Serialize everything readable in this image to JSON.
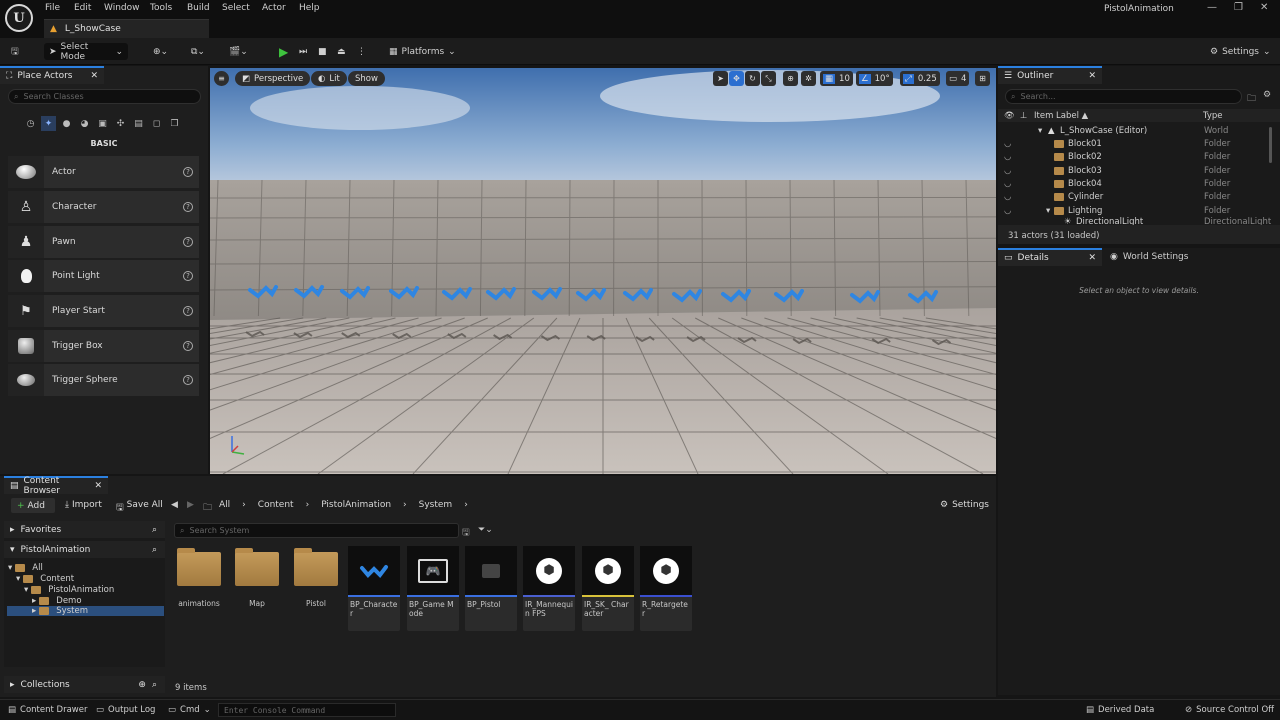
{
  "app": {
    "logo": "U",
    "menu": [
      "File",
      "Edit",
      "Window",
      "Tools",
      "Build",
      "Select",
      "Actor",
      "Help"
    ],
    "project": "PistolAnimation",
    "level_tab": "L_ShowCase"
  },
  "toolbar": {
    "mode": "Select Mode",
    "platforms": "Platforms",
    "settings": "Settings"
  },
  "place_actors": {
    "title": "Place Actors",
    "search_placeholder": "Search Classes",
    "section": "BASIC",
    "items": [
      "Actor",
      "Character",
      "Pawn",
      "Point Light",
      "Player Start",
      "Trigger Box",
      "Trigger Sphere"
    ]
  },
  "viewport": {
    "perspective": "Perspective",
    "lit": "Lit",
    "show": "Show",
    "grid": "10",
    "rot": "10°",
    "scale": "0.25",
    "cam": "4"
  },
  "outliner": {
    "title": "Outliner",
    "search_placeholder": "Search...",
    "col_label": "Item Label ▲",
    "col_type": "Type",
    "rows": [
      {
        "label": "L_ShowCase (Editor)",
        "type": "World"
      },
      {
        "label": "Block01",
        "type": "Folder"
      },
      {
        "label": "Block02",
        "type": "Folder"
      },
      {
        "label": "Block03",
        "type": "Folder"
      },
      {
        "label": "Block04",
        "type": "Folder"
      },
      {
        "label": "Cylinder",
        "type": "Folder"
      },
      {
        "label": "Lighting",
        "type": "Folder"
      },
      {
        "label": "DirectionalLight",
        "type": "DirectionalLight"
      }
    ],
    "count": "31 actors (31 loaded)"
  },
  "details": {
    "tab": "Details",
    "tab2": "World Settings",
    "empty": "Select an object to view details."
  },
  "content_browser": {
    "title": "Content Browser",
    "add": "Add",
    "import": "Import",
    "save_all": "Save All",
    "settings": "Settings",
    "path": [
      "All",
      "Content",
      "PistolAnimation",
      "System"
    ],
    "favorites": "Favorites",
    "project": "PistolAnimation",
    "tree": [
      "All",
      "Content",
      "PistolAnimation",
      "Demo",
      "System"
    ],
    "collections": "Collections",
    "search_placeholder": "Search System",
    "folders": [
      "animations",
      "Map",
      "Pistol"
    ],
    "assets": [
      {
        "name": "BP_Character",
        "color": "#3a6fe0"
      },
      {
        "name": "BP_Game Mode",
        "color": "#3a6fe0"
      },
      {
        "name": "BP_Pistol",
        "color": "#3a6fe0"
      },
      {
        "name": "IR_Mannequin FPS",
        "color": "#4a5fd0"
      },
      {
        "name": "IR_SK_ Character",
        "color": "#d8c23a"
      },
      {
        "name": "R_Retargeter",
        "color": "#3a4fd0"
      }
    ],
    "count": "9 items"
  },
  "status": {
    "drawer": "Content Drawer",
    "log": "Output Log",
    "cmd": "Cmd",
    "console_placeholder": "Enter Console Command",
    "derived": "Derived Data",
    "source": "Source Control Off"
  }
}
